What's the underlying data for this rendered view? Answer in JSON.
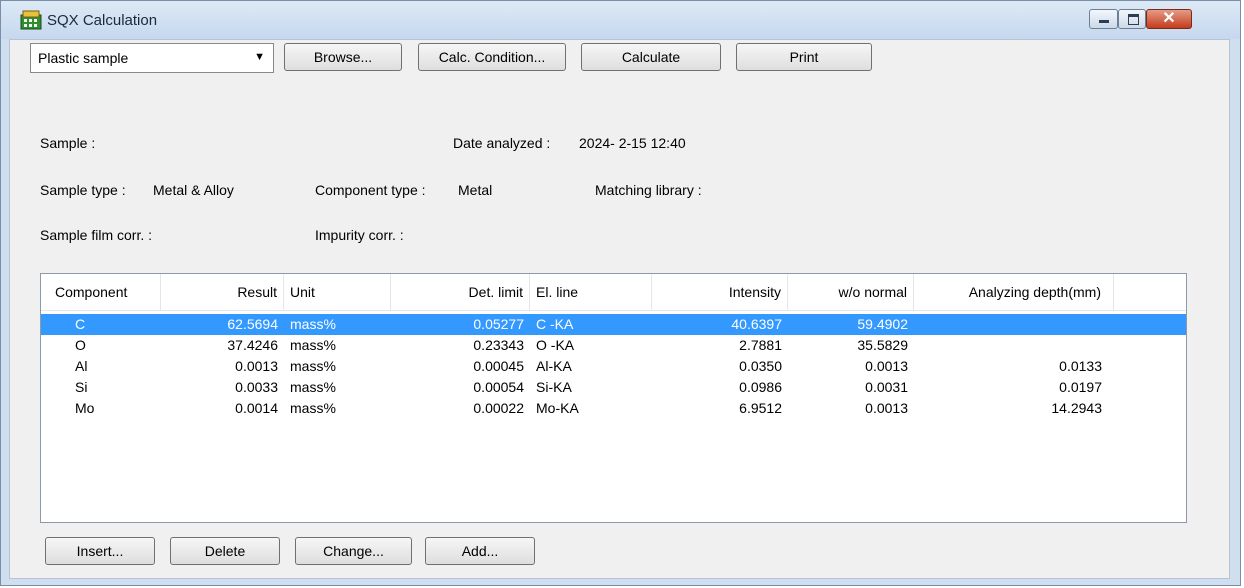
{
  "window": {
    "title": "SQX Calculation",
    "close_glyph": "✕"
  },
  "toolbar": {
    "combo_value": "Plastic sample",
    "browse": "Browse...",
    "calc_condition": "Calc. Condition...",
    "calculate": "Calculate",
    "print": "Print"
  },
  "info": {
    "sample_label": "Sample :",
    "date_label": "Date analyzed :",
    "date_value": "2024- 2-15 12:40",
    "sample_type_label": "Sample type :",
    "sample_type_value": "Metal & Alloy",
    "component_type_label": "Component type :",
    "component_type_value": "Metal",
    "matching_library_label": "Matching library :",
    "film_corr_label": "Sample film corr. :",
    "impurity_corr_label": "Impurity corr. :"
  },
  "table": {
    "headers": [
      "Component",
      "Result",
      "Unit",
      "Det. limit",
      "El. line",
      "Intensity",
      "w/o normal",
      "Analyzing depth(mm)"
    ],
    "rows": [
      {
        "component": "C",
        "result": "62.5694",
        "unit": "mass%",
        "det_limit": "0.05277",
        "el_line": "C -KA",
        "intensity": "40.6397",
        "wo_normal": "59.4902",
        "depth": "",
        "selected": true
      },
      {
        "component": "O",
        "result": "37.4246",
        "unit": "mass%",
        "det_limit": "0.23343",
        "el_line": "O -KA",
        "intensity": "2.7881",
        "wo_normal": "35.5829",
        "depth": ""
      },
      {
        "component": "Al",
        "result": "0.0013",
        "unit": "mass%",
        "det_limit": "0.00045",
        "el_line": "Al-KA",
        "intensity": "0.0350",
        "wo_normal": "0.0013",
        "depth": "0.0133"
      },
      {
        "component": "Si",
        "result": "0.0033",
        "unit": "mass%",
        "det_limit": "0.00054",
        "el_line": "Si-KA",
        "intensity": "0.0986",
        "wo_normal": "0.0031",
        "depth": "0.0197"
      },
      {
        "component": "Mo",
        "result": "0.0014",
        "unit": "mass%",
        "det_limit": "0.00022",
        "el_line": "Mo-KA",
        "intensity": "6.9512",
        "wo_normal": "0.0013",
        "depth": "14.2943"
      }
    ]
  },
  "bottom": {
    "insert": "Insert...",
    "delete": "Delete",
    "change": "Change...",
    "add": "Add..."
  },
  "colors": {
    "selection": "#3399ff",
    "window_frame": "#cfdff0",
    "close_button": "#c33b1c"
  },
  "icons": {
    "app": "calculator-app-icon",
    "minimize": "minimize-icon",
    "maximize": "maximize-icon",
    "close": "close-icon",
    "dropdown": "chevron-down-icon"
  }
}
